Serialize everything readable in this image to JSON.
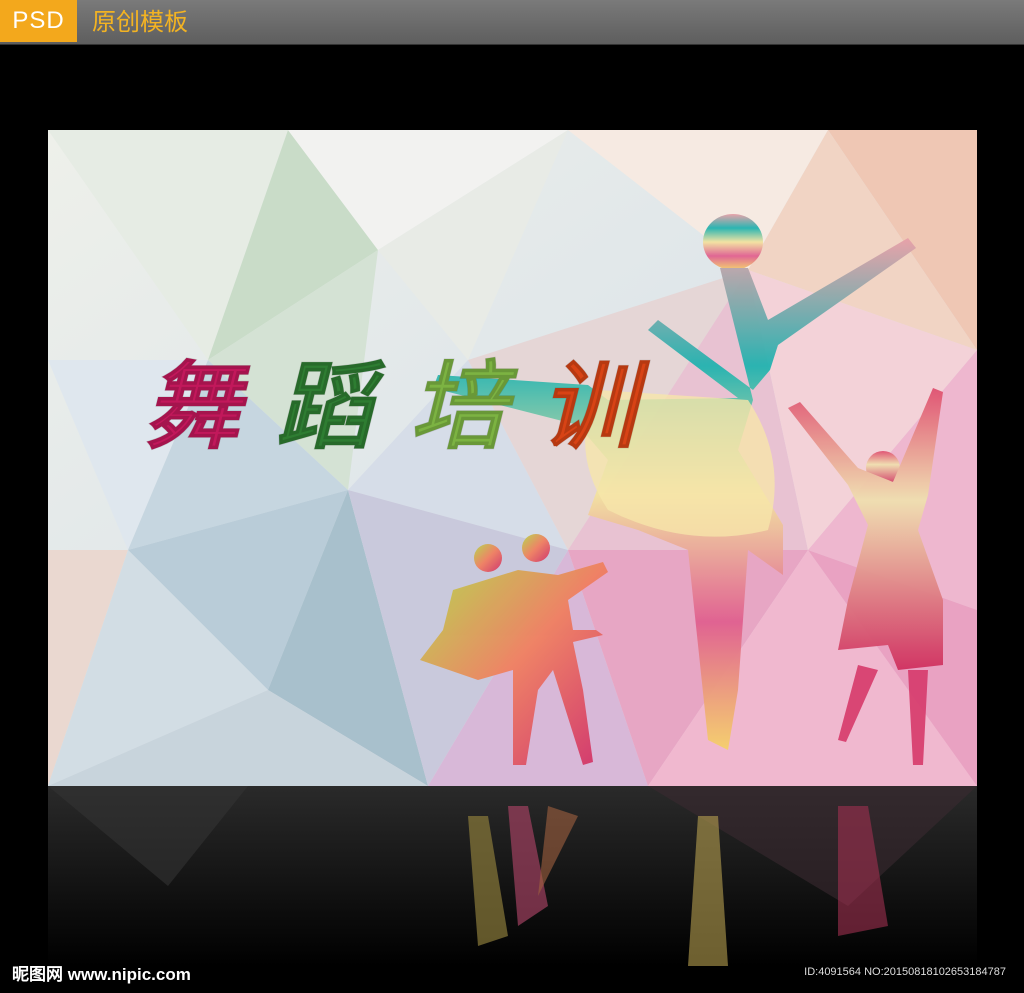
{
  "header": {
    "badge": "PSD",
    "title": "原创模板"
  },
  "poster": {
    "headline_chars": [
      "舞",
      "蹈",
      "培",
      "训"
    ],
    "headline_colors": [
      "#c2185b",
      "#2e7d32",
      "#7cb342",
      "#d84315"
    ],
    "figures": [
      "ballerina-large",
      "dancer-right",
      "dancer-pair-left"
    ]
  },
  "footer": {
    "site_logo": "昵图网 www.nipic.com",
    "image_id": "ID:4091564 NO:20150818102653184787"
  }
}
